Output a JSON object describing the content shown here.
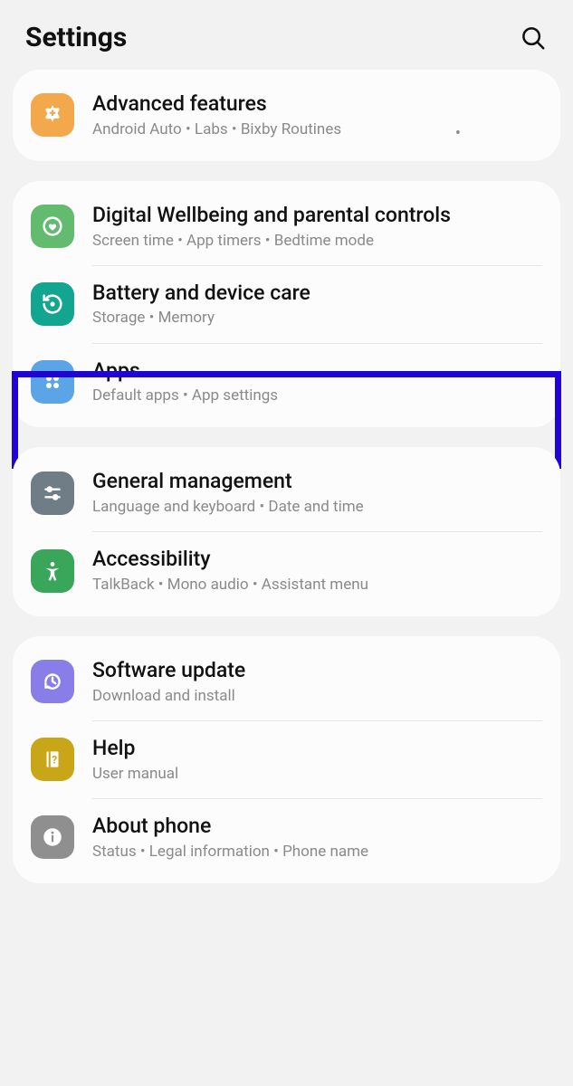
{
  "header": {
    "title": "Settings"
  },
  "groups": [
    {
      "items": [
        {
          "key": "advanced",
          "title": "Advanced features",
          "sub": "Android Auto  •  Labs  •  Bixby Routines"
        }
      ]
    },
    {
      "items": [
        {
          "key": "wellbeing",
          "title": "Digital Wellbeing and parental controls",
          "sub": "Screen time  •  App timers  •  Bedtime mode"
        },
        {
          "key": "battery",
          "title": "Battery and device care",
          "sub": "Storage  •  Memory"
        },
        {
          "key": "apps",
          "title": "Apps",
          "sub": "Default apps  •  App settings"
        }
      ]
    },
    {
      "items": [
        {
          "key": "general",
          "title": "General management",
          "sub": "Language and keyboard  •  Date and time"
        },
        {
          "key": "accessibility",
          "title": "Accessibility",
          "sub": "TalkBack  •  Mono audio  •  Assistant menu"
        }
      ]
    },
    {
      "items": [
        {
          "key": "software",
          "title": "Software update",
          "sub": "Download and install"
        },
        {
          "key": "help",
          "title": "Help",
          "sub": "User manual"
        },
        {
          "key": "about",
          "title": "About phone",
          "sub": "Status  •  Legal information  •  Phone name"
        }
      ]
    }
  ]
}
